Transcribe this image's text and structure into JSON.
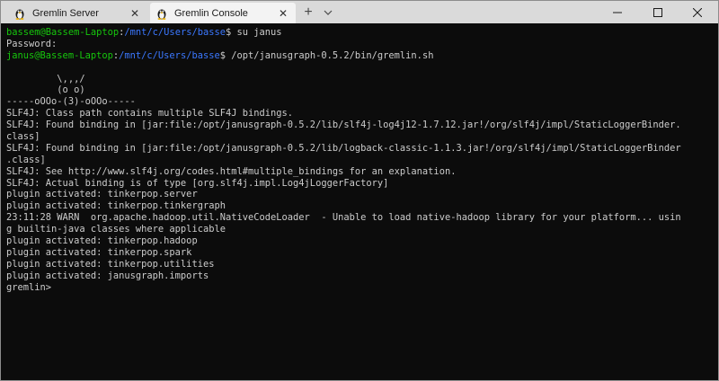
{
  "tabs": [
    {
      "title": "Gremlin Server",
      "active": false,
      "icon": "tux-icon"
    },
    {
      "title": "Gremlin Console",
      "active": true,
      "icon": "tux-icon"
    }
  ],
  "new_tab_label": "+",
  "colors": {
    "prompt_user": "#16c60c",
    "prompt_path": "#3b78ff",
    "text": "#cccccc",
    "background": "#0c0c0c",
    "titlebar": "#dadada",
    "active_tab": "#f3f3f3"
  },
  "terminal": {
    "prompt1": {
      "user": "bassem@Bassem-Laptop",
      "sep": ":",
      "path": "/mnt/c/Users/basse",
      "cmd": "$ su janus"
    },
    "password": "Password:",
    "prompt2": {
      "user": "janus@Bassem-Laptop",
      "sep": ":",
      "path": "/mnt/c/Users/basse",
      "cmd": "$ /opt/janusgraph-0.5.2/bin/gremlin.sh"
    },
    "output": [
      "",
      "         \\,,,/",
      "         (o o)",
      "-----oOOo-(3)-oOOo-----",
      "SLF4J: Class path contains multiple SLF4J bindings.",
      "SLF4J: Found binding in [jar:file:/opt/janusgraph-0.5.2/lib/slf4j-log4j12-1.7.12.jar!/org/slf4j/impl/StaticLoggerBinder.",
      "class]",
      "SLF4J: Found binding in [jar:file:/opt/janusgraph-0.5.2/lib/logback-classic-1.1.3.jar!/org/slf4j/impl/StaticLoggerBinder",
      ".class]",
      "SLF4J: See http://www.slf4j.org/codes.html#multiple_bindings for an explanation.",
      "SLF4J: Actual binding is of type [org.slf4j.impl.Log4jLoggerFactory]",
      "plugin activated: tinkerpop.server",
      "plugin activated: tinkerpop.tinkergraph",
      "23:11:28 WARN  org.apache.hadoop.util.NativeCodeLoader  - Unable to load native-hadoop library for your platform... usin",
      "g builtin-java classes where applicable",
      "plugin activated: tinkerpop.hadoop",
      "plugin activated: tinkerpop.spark",
      "plugin activated: tinkerpop.utilities",
      "plugin activated: janusgraph.imports",
      "gremlin>"
    ]
  }
}
